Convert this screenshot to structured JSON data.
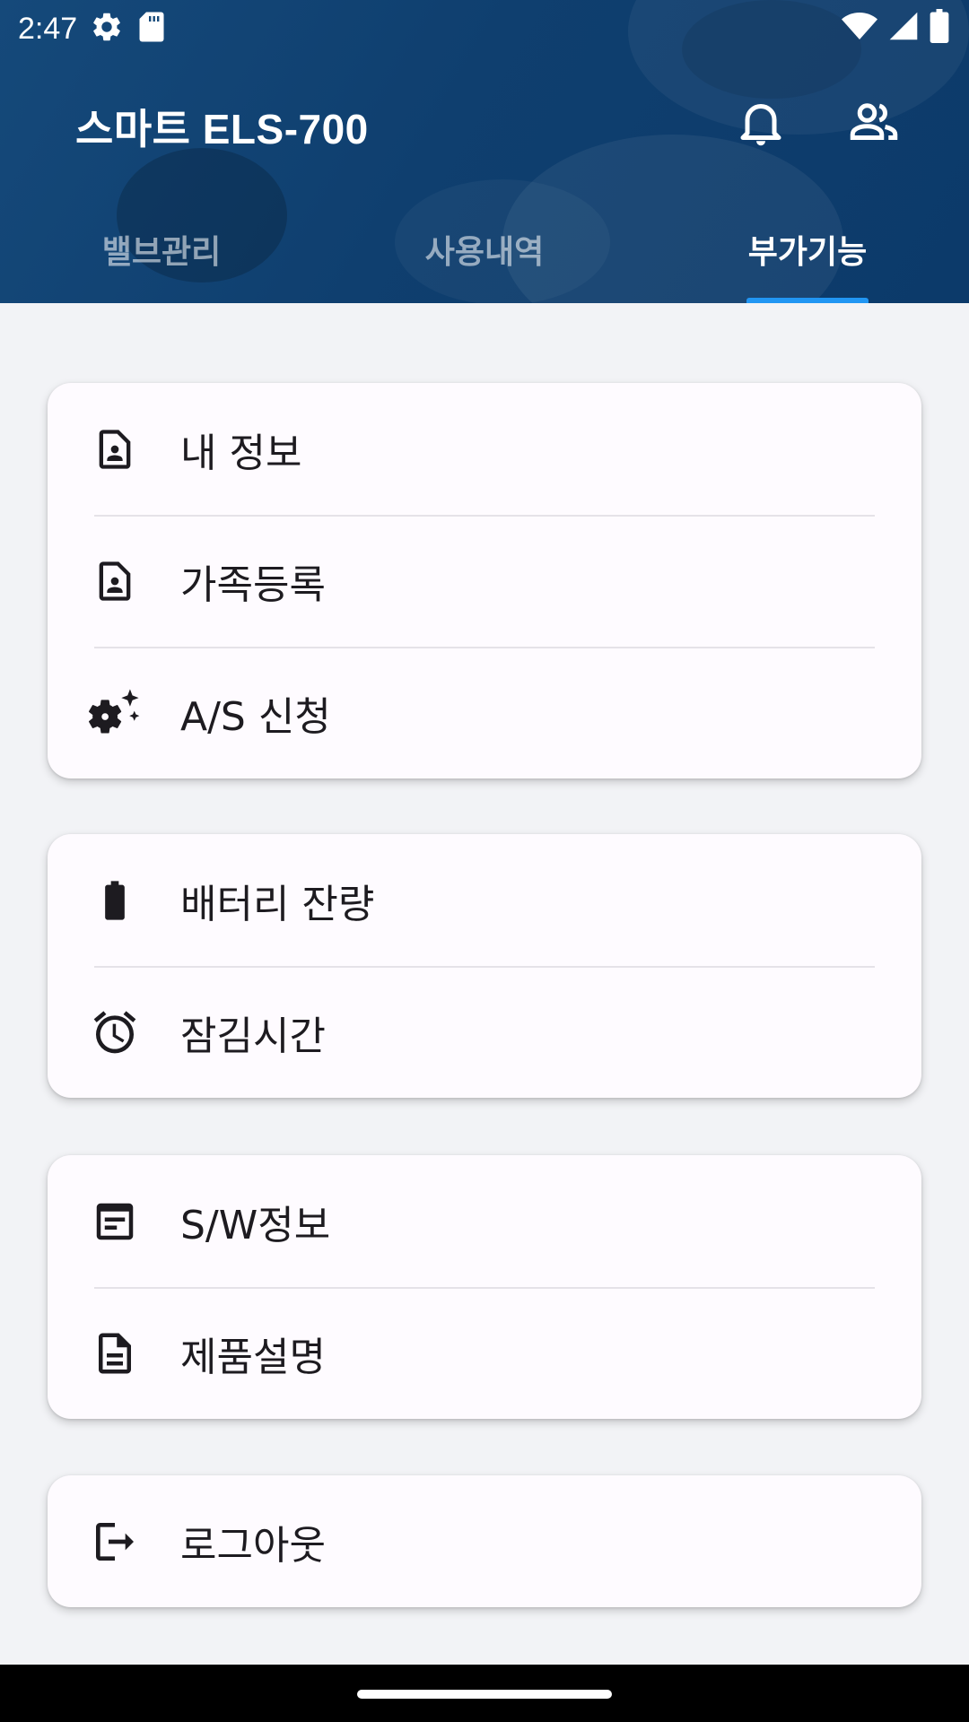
{
  "status_bar": {
    "time": "2:47",
    "icons_left": [
      "settings-gear-icon",
      "sd-card-icon"
    ],
    "icons_right": [
      "wifi-icon",
      "cell-signal-icon",
      "battery-icon"
    ]
  },
  "header": {
    "title": "스마트 ELS-700",
    "actions": [
      "bell-icon",
      "people-icon"
    ],
    "background_color": "#0f3f6f"
  },
  "tabs": [
    {
      "label": "밸브관리",
      "active": false
    },
    {
      "label": "사용내역",
      "active": false
    },
    {
      "label": "부가기능",
      "active": true
    }
  ],
  "accent_color": "#2196f3",
  "menu_groups": [
    {
      "items": [
        {
          "label": "내 정보",
          "icon": "contact-page-icon"
        },
        {
          "label": "가족등록",
          "icon": "contact-page-icon"
        },
        {
          "label": "A/S 신청",
          "icon": "settings-sparkle-icon"
        }
      ]
    },
    {
      "items": [
        {
          "label": "배터리 잔량",
          "icon": "battery-icon"
        },
        {
          "label": "잠김시간",
          "icon": "alarm-clock-icon"
        }
      ]
    },
    {
      "items": [
        {
          "label": "S/W정보",
          "icon": "article-icon"
        },
        {
          "label": "제품설명",
          "icon": "description-icon"
        }
      ]
    },
    {
      "items": [
        {
          "label": "로그아웃",
          "icon": "logout-icon"
        }
      ]
    }
  ]
}
